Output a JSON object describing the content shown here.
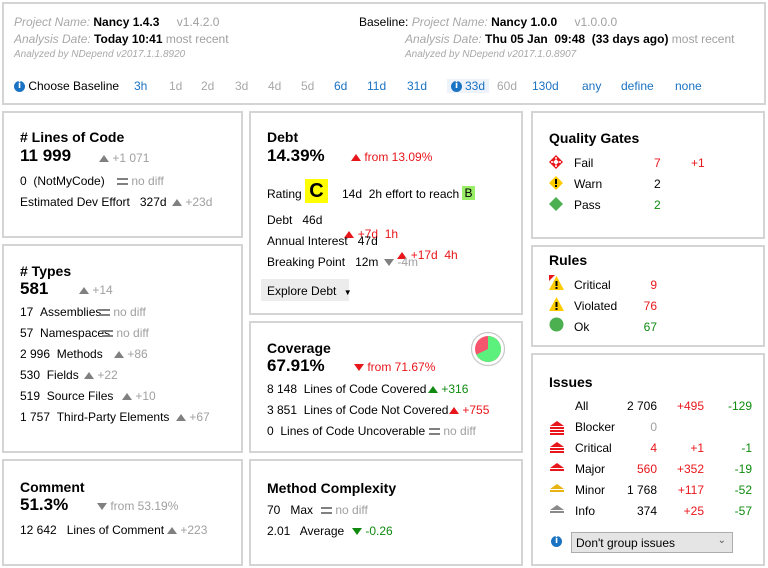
{
  "header": {
    "current": {
      "project_label": "Project Name:",
      "project_name": "Nancy 1.4.3",
      "version": "v1.4.2.0",
      "date_label": "Analysis Date:",
      "date": "Today 10:41",
      "date_note": "most recent",
      "analyzed_by": "Analyzed by NDepend v2017.1.1.8920"
    },
    "baseline": {
      "label": "Baseline:",
      "project_label": "Project Name:",
      "project_name": "Nancy 1.0.0",
      "version": "v1.0.0.0",
      "date_label": "Analysis Date:",
      "date": "Thu 05 Jan  09:48  (33 days ago)",
      "date_note": "most recent",
      "analyzed_by": "Analyzed by NDepend v2017.1.0.8907"
    },
    "choose_baseline_label": "Choose Baseline",
    "baseline_options": [
      {
        "label": "3h",
        "enabled": true
      },
      {
        "label": "1d",
        "enabled": false
      },
      {
        "label": "2d",
        "enabled": false
      },
      {
        "label": "3d",
        "enabled": false
      },
      {
        "label": "4d",
        "enabled": false
      },
      {
        "label": "5d",
        "enabled": false
      },
      {
        "label": "6d",
        "enabled": true
      },
      {
        "label": "11d",
        "enabled": true
      },
      {
        "label": "31d",
        "enabled": true
      },
      {
        "label": "33d",
        "enabled": true,
        "selected": true
      },
      {
        "label": "60d",
        "enabled": false
      },
      {
        "label": "130d",
        "enabled": true
      },
      {
        "label": "any",
        "enabled": true
      },
      {
        "label": "define",
        "enabled": true
      },
      {
        "label": "none",
        "enabled": true
      }
    ]
  },
  "loc": {
    "title": "# Lines of Code",
    "value": "11 999",
    "delta": "+1 071",
    "notmycode_value": "0",
    "notmycode_label": "(NotMyCode)",
    "notmycode_delta": "no diff",
    "effort_label": "Estimated Dev Effort",
    "effort_value": "327d",
    "effort_delta": "+23d"
  },
  "types": {
    "title": "# Types",
    "value": "581",
    "delta": "+14",
    "rows": [
      {
        "value": "17",
        "label": "Assemblies",
        "delta": "no diff",
        "trend": "eq"
      },
      {
        "value": "57",
        "label": "Namespaces",
        "delta": "no diff",
        "trend": "eq"
      },
      {
        "value": "2 996",
        "label": "Methods",
        "delta": "+86",
        "trend": "up"
      },
      {
        "value": "530",
        "label": "Fields",
        "delta": "+22",
        "trend": "up"
      },
      {
        "value": "519",
        "label": "Source Files",
        "delta": "+10",
        "trend": "up"
      },
      {
        "value": "1 757",
        "label": "Third-Party Elements",
        "delta": "+67",
        "trend": "up"
      }
    ]
  },
  "comment": {
    "title": "Comment",
    "value": "51.3%",
    "delta": "from 53.19%",
    "lines_value": "12 642",
    "lines_label": "Lines of Comment",
    "lines_delta": "+223"
  },
  "debt": {
    "title": "Debt",
    "value": "14.39%",
    "delta": "from 13.09%",
    "rating_label": "Rating",
    "rating": "C",
    "rating_color": "#ffff00",
    "effort_text": "14d  2h effort to reach",
    "next_rating": "B",
    "next_rating_color": "#99ee66",
    "debt_label": "Debt",
    "debt_value": "46d",
    "debt_delta": "+7d  1h",
    "interest_label": "Annual Interest",
    "interest_value": "47d",
    "interest_delta": "+17d  4h",
    "breaking_label": "Breaking Point",
    "breaking_value": "12m",
    "breaking_delta": "-4m",
    "explore_label": "Explore Debt"
  },
  "coverage": {
    "title": "Coverage",
    "value": "67.91%",
    "coverage_fraction": 0.6791,
    "delta": "from 71.67%",
    "rows": [
      {
        "value": "8 148",
        "label": "Lines of Code Covered",
        "delta": "+316",
        "trend": "up-green"
      },
      {
        "value": "3 851",
        "label": "Lines of Code Not Covered",
        "delta": "+755",
        "trend": "up-red"
      },
      {
        "value": "0",
        "label": "Lines of Code Uncoverable",
        "delta": "no diff",
        "trend": "eq"
      }
    ],
    "covered_color": "#5cf07c",
    "uncovered_color": "#f5566e"
  },
  "complexity": {
    "title": "Method Complexity",
    "max_value": "70",
    "max_label": "Max",
    "max_delta": "no diff",
    "avg_value": "2.01",
    "avg_label": "Average",
    "avg_delta": "-0.26"
  },
  "quality_gates": {
    "title": "Quality Gates",
    "rows": [
      {
        "label": "Fail",
        "count": "7",
        "delta": "+1"
      },
      {
        "label": "Warn",
        "count": "2",
        "delta": ""
      },
      {
        "label": "Pass",
        "count": "2",
        "delta": ""
      }
    ]
  },
  "rules": {
    "title": "Rules",
    "rows": [
      {
        "label": "Critical",
        "count": "9"
      },
      {
        "label": "Violated",
        "count": "76"
      },
      {
        "label": "Ok",
        "count": "67"
      }
    ]
  },
  "issues": {
    "title": "Issues",
    "rows": [
      {
        "label": "All",
        "count": "2 706",
        "added": "+495",
        "removed": "-129"
      },
      {
        "label": "Blocker",
        "count": "0",
        "added": "",
        "removed": ""
      },
      {
        "label": "Critical",
        "count": "4",
        "added": "+1",
        "removed": "-1"
      },
      {
        "label": "Major",
        "count": "560",
        "added": "+352",
        "removed": "-19"
      },
      {
        "label": "Minor",
        "count": "1 768",
        "added": "+117",
        "removed": "-52"
      },
      {
        "label": "Info",
        "count": "374",
        "added": "+25",
        "removed": "-57"
      }
    ],
    "group_select_value": "Don't group issues"
  }
}
